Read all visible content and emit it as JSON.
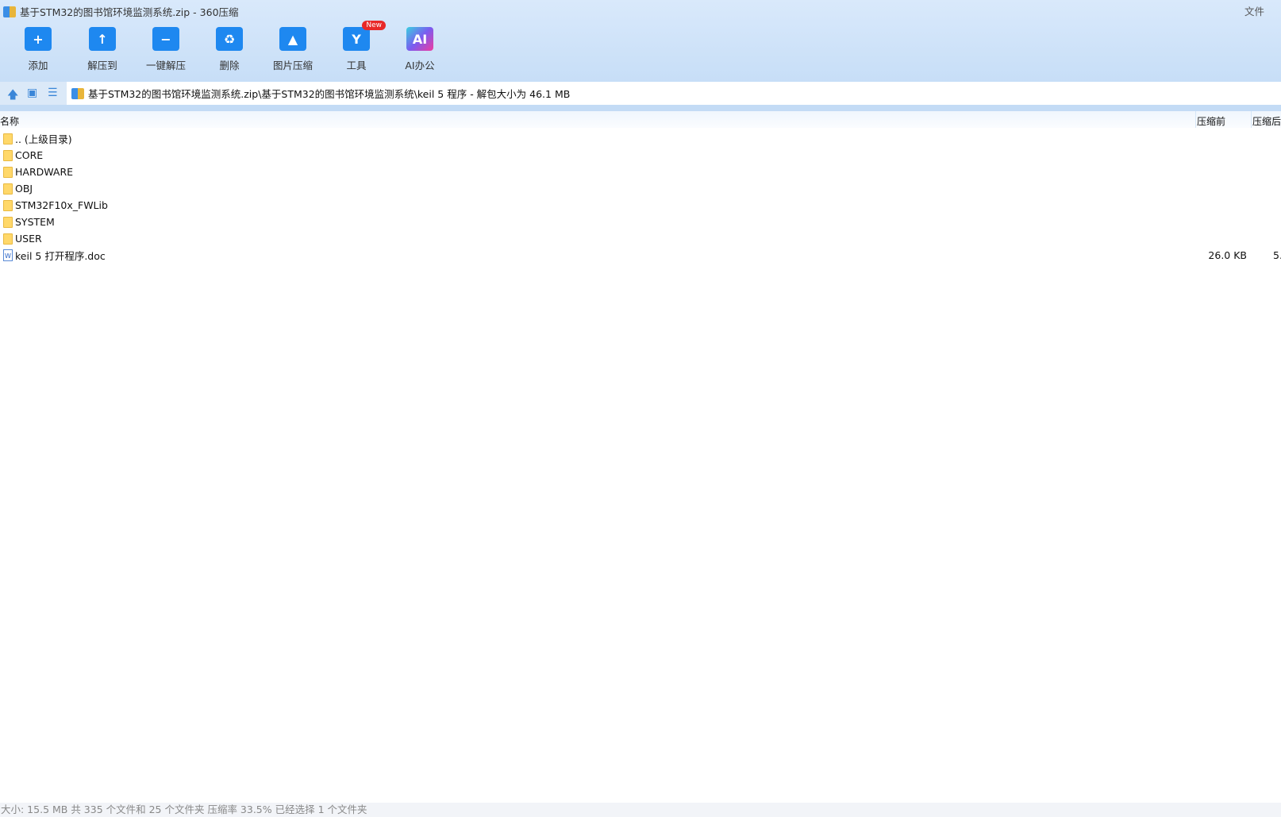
{
  "window": {
    "title": "基于STM32的图书馆环境监测系统.zip - 360压缩",
    "file_menu": "文件"
  },
  "toolbar": [
    {
      "label": "添加",
      "icon": "add-folder-icon",
      "glyph": "+"
    },
    {
      "label": "解压到",
      "icon": "extract-to-icon",
      "glyph": "↑"
    },
    {
      "label": "一键解压",
      "icon": "one-click-extract-icon",
      "glyph": "−"
    },
    {
      "label": "删除",
      "icon": "recycle-bin-icon",
      "glyph": "♻"
    },
    {
      "label": "图片压缩",
      "icon": "image-compress-icon",
      "glyph": "▲"
    },
    {
      "label": "工具",
      "icon": "tools-icon",
      "glyph": "Y",
      "badge": "New"
    },
    {
      "label": "AI办公",
      "icon": "ai-office-icon",
      "glyph": "AI"
    }
  ],
  "address": {
    "path": "基于STM32的图书馆环境监测系统.zip\\基于STM32的图书馆环境监测系统\\keil 5 程序 - 解包大小为 46.1 MB"
  },
  "columns": {
    "name": "名称",
    "original": "压缩前",
    "compressed": "压缩后"
  },
  "files": [
    {
      "name": ".. (上级目录)",
      "type": "folder"
    },
    {
      "name": "CORE",
      "type": "folder"
    },
    {
      "name": "HARDWARE",
      "type": "folder"
    },
    {
      "name": "OBJ",
      "type": "folder"
    },
    {
      "name": "STM32F10x_FWLib",
      "type": "folder"
    },
    {
      "name": "SYSTEM",
      "type": "folder"
    },
    {
      "name": "USER",
      "type": "folder"
    },
    {
      "name": "keil 5 打开程序.doc",
      "type": "doc",
      "size": "26.0 KB",
      "compressed": "5."
    }
  ],
  "status": "大小: 15.5 MB 共 335 个文件和 25 个文件夹 压缩率 33.5% 已经选择 1 个文件夹"
}
